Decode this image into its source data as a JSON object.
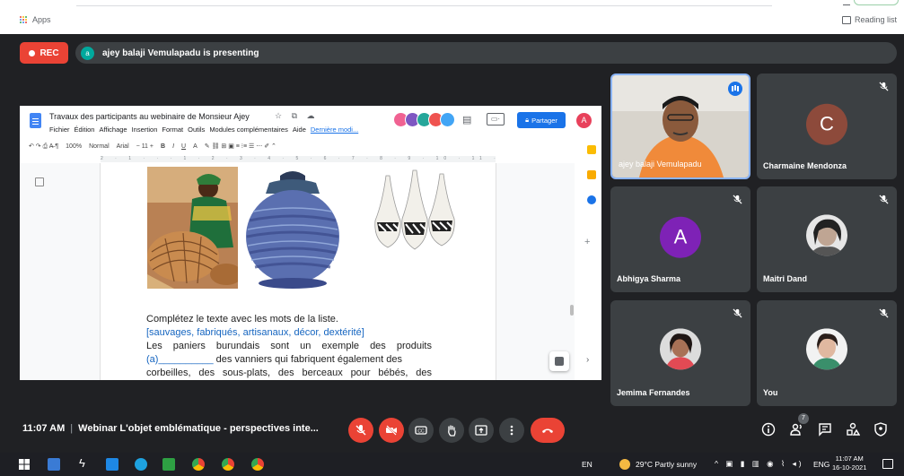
{
  "browser": {
    "apps_label": "Apps",
    "reading_list_label": "Reading list"
  },
  "meet": {
    "rec_label": "REC",
    "presenter_initial": "a",
    "presenting_text": "ajey balaji Vemulapadu is presenting",
    "time": "11:07 AM",
    "meeting_title": "Webinar L'objet emblématique - perspectives inte...",
    "participants_count": "7",
    "participants": [
      {
        "name": "ajey balaji Vemulapadu",
        "initial": "",
        "color": "",
        "speaking": true
      },
      {
        "name": "Charmaine Mendonza",
        "initial": "C",
        "color": "#8d4a3b"
      },
      {
        "name": "Abhigya Sharma",
        "initial": "A",
        "color": "#7e22b6"
      },
      {
        "name": "Maitri Dand",
        "initial": "",
        "color": ""
      },
      {
        "name": "Jemima Fernandes",
        "initial": "",
        "color": ""
      },
      {
        "name": "You",
        "initial": "",
        "color": ""
      }
    ]
  },
  "doc": {
    "title": "Travaux des participants au webinaire de Monsieur Ajey",
    "title_icons": "☆ ⧉ ☁",
    "menu": [
      "Fichier",
      "Édition",
      "Affichage",
      "Insertion",
      "Format",
      "Outils",
      "Modules complémentaires",
      "Aide"
    ],
    "last_edit": "Dernière modi...",
    "share_label": "Partager",
    "avatar_initial": "A",
    "toolbar": {
      "zoom": "100%",
      "style": "Normal",
      "font": "Arial",
      "size": "11",
      "bold": "B",
      "italic": "I",
      "underline": "U",
      "color": "A"
    },
    "ruler": "2 · 1 · · · 1 · 2 · 3 · 4 · 5 · 6 · 7 · 8 · 9 · 10 · 11 · 12 · 13 · 14 · 15 · 16 · 17 · 18",
    "line1": "Complétez le texte avec les mots de la liste.",
    "line2": "[sauvages,  fabriqués,  artisanaux,  décor,  dextérité]",
    "line3": "Les   paniers   burundais   sont   un   exemple   des   produits",
    "line4a": "(a)__________",
    "line4b": "  des vanniers qui fabriquent également des",
    "line5": "corbeilles,  des  sous-plats,  des  berceaux  pour  bébés,  des"
  },
  "taskbar": {
    "lang": "EN",
    "weather": "29°C  Partly sunny",
    "ime": "ENG",
    "time": "11:07 AM",
    "date": "16-10-2021"
  },
  "colors": {
    "meet_bg": "#202124",
    "tile_bg": "#3c4043",
    "rec_red": "#ea4335",
    "google_blue": "#1a73e8"
  },
  "icons": {
    "mic": "mic-off-icon",
    "cam": "camera-off-icon",
    "cc": "captions-icon",
    "hand": "raise-hand-icon",
    "present": "present-icon",
    "more": "more-vert-icon",
    "end": "end-call-icon",
    "info": "info-icon",
    "people": "people-icon",
    "chat": "chat-icon",
    "activities": "activities-icon",
    "host": "host-controls-icon"
  }
}
